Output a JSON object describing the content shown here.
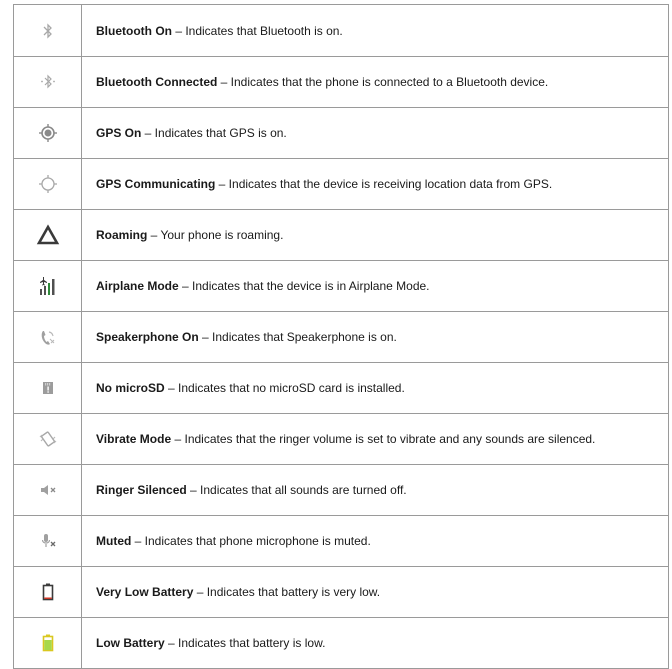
{
  "rows": [
    {
      "icon": "bluetooth-icon",
      "term": "Bluetooth On",
      "desc": " – Indicates that Bluetooth is on."
    },
    {
      "icon": "bluetooth-connected-icon",
      "term": "Bluetooth Connected",
      "desc": " – Indicates that the phone is connected to a Bluetooth device."
    },
    {
      "icon": "gps-on-icon",
      "term": "GPS On",
      "desc": " – Indicates that GPS is on."
    },
    {
      "icon": "gps-communicating-icon",
      "term": "GPS Communicating",
      "desc": " – Indicates that the device is receiving location data from GPS."
    },
    {
      "icon": "roaming-triangle-icon",
      "term": "Roaming",
      "desc": " – Your phone is roaming."
    },
    {
      "icon": "airplane-mode-icon",
      "term": "Airplane Mode",
      "desc": " – Indicates that the device is in Airplane Mode."
    },
    {
      "icon": "speakerphone-icon",
      "term": "Speakerphone On",
      "desc": " – Indicates that Speakerphone is on."
    },
    {
      "icon": "no-microsd-icon",
      "term": "No microSD",
      "desc": " – Indicates that no microSD card is installed."
    },
    {
      "icon": "vibrate-icon",
      "term": "Vibrate Mode",
      "desc": " – Indicates that the ringer volume is set to vibrate and any sounds are silenced."
    },
    {
      "icon": "ringer-silenced-icon",
      "term": "Ringer Silenced",
      "desc": " – Indicates that all sounds are turned off."
    },
    {
      "icon": "microphone-muted-icon",
      "term": "Muted",
      "desc": " – Indicates that phone microphone is muted."
    },
    {
      "icon": "battery-very-low-icon",
      "term": "Very Low Battery",
      "desc": " – Indicates that battery is very low."
    },
    {
      "icon": "battery-low-icon",
      "term": "Low Battery",
      "desc": " – Indicates that battery is low."
    }
  ],
  "colors": {
    "border": "#9a9a9a",
    "icon_gray": "#a8a8a8",
    "icon_dark": "#404040",
    "battery_red": "#d9301e",
    "battery_yellow": "#d6d21c"
  }
}
